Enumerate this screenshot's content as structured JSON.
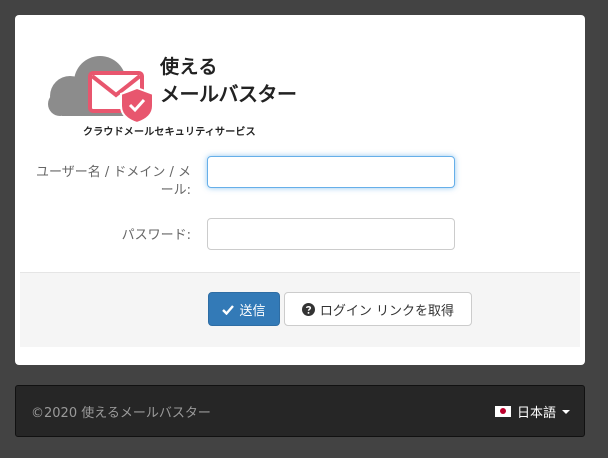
{
  "logo": {
    "line1": "使える",
    "line2": "メールバスター",
    "tagline": "クラウドメールセキュリティサービス",
    "icon": "cloud-envelope-shield-icon",
    "brand_color": "#e8566e",
    "cloud_color": "#8c8c8c"
  },
  "form": {
    "user_label": "ユーザー名 / ドメイン / メール:",
    "user_value": "",
    "password_label": "パスワード:",
    "password_value": ""
  },
  "actions": {
    "send_label": "送信",
    "send_icon": "check-icon",
    "login_link_label": "ログイン リンクを取得",
    "login_link_icon": "question-circle-icon"
  },
  "footer": {
    "copyright": "©2020 使えるメールバスター",
    "language": "日本語",
    "language_flag": "japan-flag-icon"
  }
}
